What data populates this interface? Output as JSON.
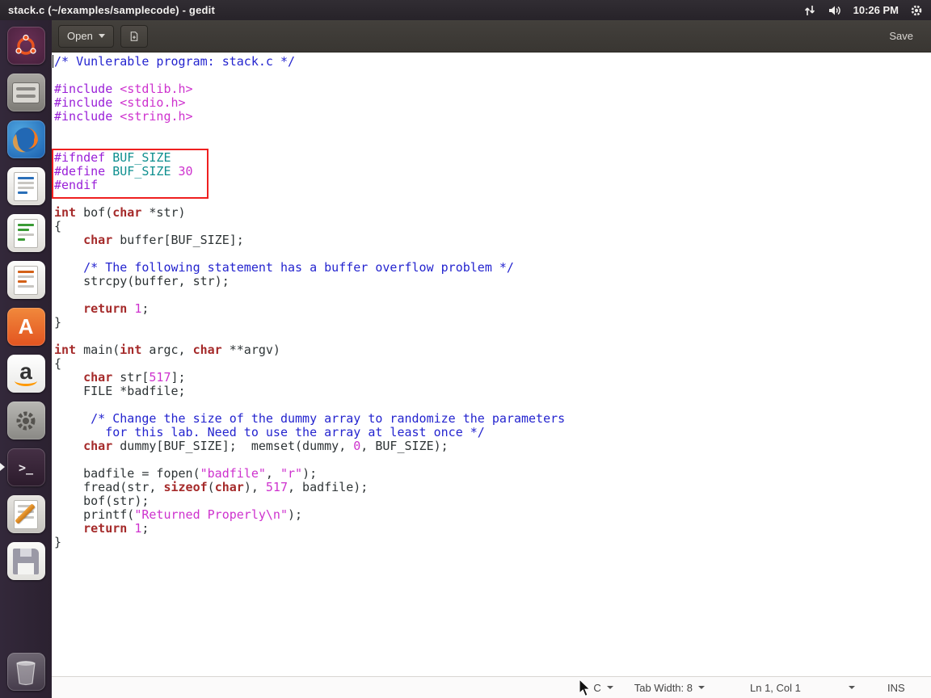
{
  "panel": {
    "title": "stack.c (~/examples/samplecode) - gedit",
    "clock": "10:26 PM"
  },
  "launcher": {
    "items": [
      {
        "name": "ubuntu-dash"
      },
      {
        "name": "files"
      },
      {
        "name": "firefox"
      },
      {
        "name": "libreoffice-writer"
      },
      {
        "name": "libreoffice-calc"
      },
      {
        "name": "libreoffice-impress"
      },
      {
        "name": "ubuntu-software",
        "glyph": "A"
      },
      {
        "name": "amazon",
        "glyph": "a"
      },
      {
        "name": "system-settings"
      },
      {
        "name": "terminal",
        "glyph": ">_"
      },
      {
        "name": "text-editor"
      },
      {
        "name": "floppy"
      },
      {
        "name": "trash"
      }
    ]
  },
  "toolbar": {
    "open_label": "Open",
    "save_label": "Save"
  },
  "statusbar": {
    "language": "C",
    "tab_width": "Tab Width: 8",
    "position": "Ln 1, Col 1",
    "mode": "INS"
  },
  "editor": {
    "lines": [
      [
        [
          "cm",
          "/* Vunlerable program: stack.c */"
        ]
      ],
      [],
      [
        [
          "pp",
          "#include "
        ],
        [
          "str",
          "<stdlib.h>"
        ]
      ],
      [
        [
          "pp",
          "#include "
        ],
        [
          "str",
          "<stdio.h>"
        ]
      ],
      [
        [
          "pp",
          "#include "
        ],
        [
          "str",
          "<string.h>"
        ]
      ],
      [],
      [],
      [
        [
          "pp",
          "#ifndef "
        ],
        [
          "mac",
          "BUF_SIZE"
        ]
      ],
      [
        [
          "pp",
          "#define "
        ],
        [
          "mac",
          "BUF_SIZE"
        ],
        [
          "df",
          " "
        ],
        [
          "num",
          "30"
        ]
      ],
      [
        [
          "pp",
          "#endif"
        ]
      ],
      [],
      [
        [
          "kw",
          "int"
        ],
        [
          "df",
          " bof("
        ],
        [
          "kw",
          "char"
        ],
        [
          "df",
          " *str)"
        ]
      ],
      [
        [
          "df",
          "{"
        ]
      ],
      [
        [
          "df",
          "    "
        ],
        [
          "kw",
          "char"
        ],
        [
          "df",
          " buffer[BUF_SIZE];"
        ]
      ],
      [],
      [
        [
          "df",
          "    "
        ],
        [
          "cm",
          "/* The following statement has a buffer overflow problem */"
        ]
      ],
      [
        [
          "df",
          "    strcpy(buffer, str);"
        ]
      ],
      [],
      [
        [
          "df",
          "    "
        ],
        [
          "kw",
          "return"
        ],
        [
          "df",
          " "
        ],
        [
          "num",
          "1"
        ],
        [
          "df",
          ";"
        ]
      ],
      [
        [
          "df",
          "}"
        ]
      ],
      [],
      [
        [
          "kw",
          "int"
        ],
        [
          "df",
          " main("
        ],
        [
          "kw",
          "int"
        ],
        [
          "df",
          " argc, "
        ],
        [
          "kw",
          "char"
        ],
        [
          "df",
          " **argv)"
        ]
      ],
      [
        [
          "df",
          "{"
        ]
      ],
      [
        [
          "df",
          "    "
        ],
        [
          "kw",
          "char"
        ],
        [
          "df",
          " str["
        ],
        [
          "num",
          "517"
        ],
        [
          "df",
          "];"
        ]
      ],
      [
        [
          "df",
          "    FILE *badfile;"
        ]
      ],
      [],
      [
        [
          "df",
          "     "
        ],
        [
          "cm",
          "/* Change the size of the dummy array to randomize the parameters"
        ]
      ],
      [
        [
          "cm",
          "       for this lab. Need to use the array at least once */"
        ]
      ],
      [
        [
          "df",
          "    "
        ],
        [
          "kw",
          "char"
        ],
        [
          "df",
          " dummy[BUF_SIZE];  memset(dummy, "
        ],
        [
          "num",
          "0"
        ],
        [
          "df",
          ", BUF_SIZE);"
        ]
      ],
      [],
      [
        [
          "df",
          "    badfile = fopen("
        ],
        [
          "str",
          "\"badfile\""
        ],
        [
          "df",
          ", "
        ],
        [
          "str",
          "\"r\""
        ],
        [
          "df",
          ");"
        ]
      ],
      [
        [
          "df",
          "    fread(str, "
        ],
        [
          "kw",
          "sizeof"
        ],
        [
          "df",
          "("
        ],
        [
          "kw",
          "char"
        ],
        [
          "df",
          "), "
        ],
        [
          "num",
          "517"
        ],
        [
          "df",
          ", badfile);"
        ]
      ],
      [
        [
          "df",
          "    bof(str);"
        ]
      ],
      [
        [
          "df",
          "    printf("
        ],
        [
          "str",
          "\"Returned Properly\\n\""
        ],
        [
          "df",
          ");"
        ]
      ],
      [
        [
          "df",
          "    "
        ],
        [
          "kw",
          "return"
        ],
        [
          "df",
          " "
        ],
        [
          "num",
          "1"
        ],
        [
          "df",
          ";"
        ]
      ],
      [
        [
          "df",
          "}"
        ]
      ]
    ]
  }
}
